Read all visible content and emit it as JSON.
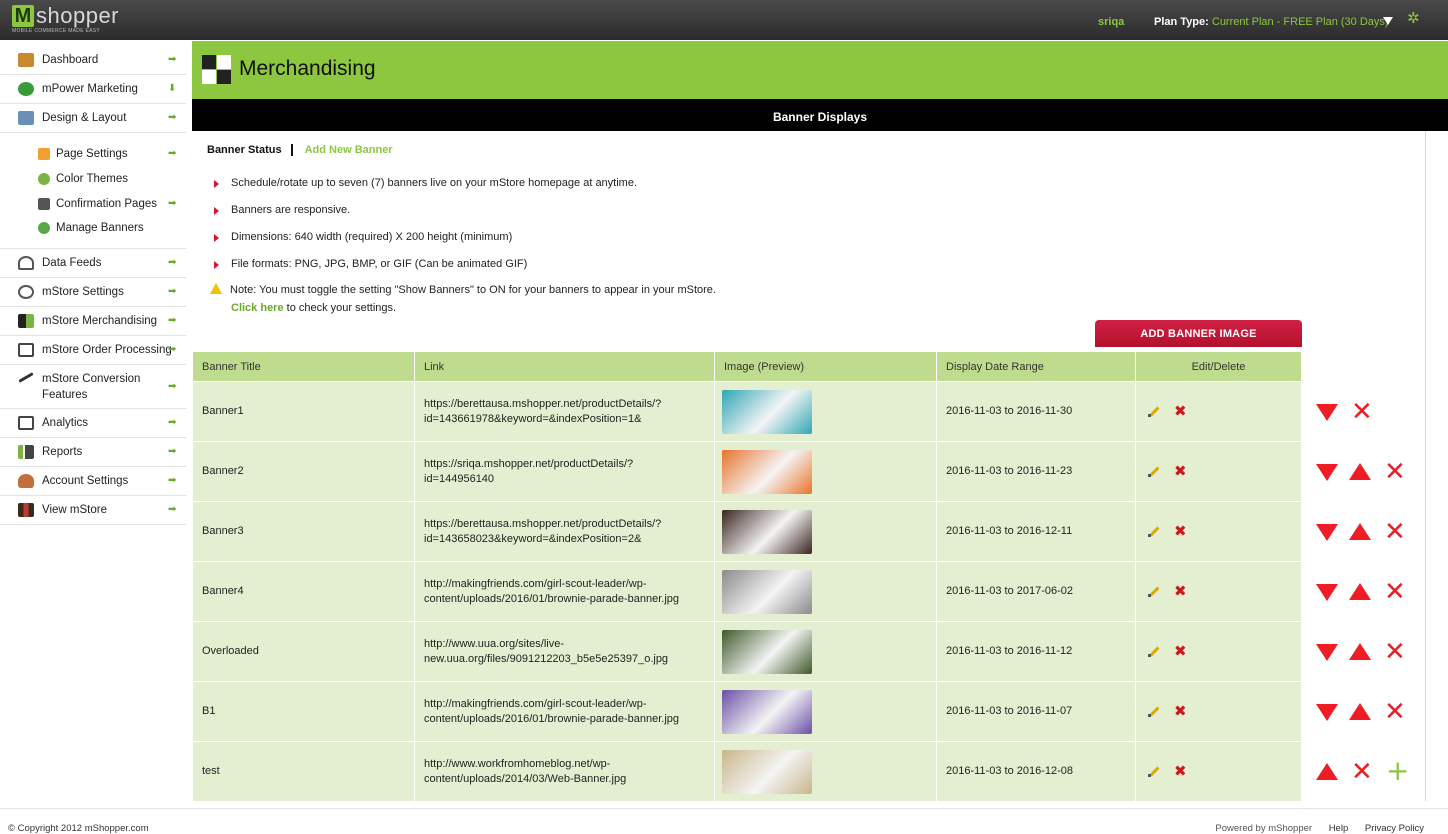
{
  "brand": {
    "logo_letter": "M",
    "logo_word": "shopper",
    "tagline": "MOBILE COMMERCE MADE EASY"
  },
  "topbar": {
    "user": "sriqa",
    "plan_label": "Plan Type:",
    "plan_value": "Current Plan - FREE Plan (30 Days)"
  },
  "sidebar": {
    "items": [
      {
        "label": "Dashboard",
        "icon": "home-icon"
      },
      {
        "label": "mPower Marketing",
        "icon": "marketing-icon"
      },
      {
        "label": "Design & Layout",
        "icon": "layout-icon"
      },
      {
        "label": "Data Feeds",
        "icon": "data-feeds-icon"
      },
      {
        "label": "mStore Settings",
        "icon": "settings-icon"
      },
      {
        "label": "mStore Merchandising",
        "icon": "merchandising-icon"
      },
      {
        "label": "mStore Order Processing",
        "icon": "order-processing-icon"
      },
      {
        "label": "mStore Conversion Features",
        "icon": "conversion-icon"
      },
      {
        "label": "Analytics",
        "icon": "analytics-icon"
      },
      {
        "label": "Reports",
        "icon": "reports-icon"
      },
      {
        "label": "Account Settings",
        "icon": "account-icon"
      },
      {
        "label": "View mStore",
        "icon": "store-icon"
      }
    ],
    "subitems": [
      {
        "label": "Page Settings",
        "icon": "page-icon"
      },
      {
        "label": "Color Themes",
        "icon": "palette-icon"
      },
      {
        "label": "Confirmation Pages",
        "icon": "confirmation-icon"
      },
      {
        "label": "Manage Banners",
        "icon": "banner-icon"
      }
    ]
  },
  "header": {
    "title": "Merchandising",
    "section": "Banner Displays"
  },
  "tabs": {
    "status": "Banner Status",
    "add": "Add New Banner"
  },
  "bullets": [
    "Schedule/rotate up to seven (7) banners live on your mStore homepage at anytime.",
    "Banners are responsive.",
    "Dimensions: 640 width (required) X 200 height (minimum)",
    "File formats: PNG, JPG, BMP, or GIF (Can be animated GIF)"
  ],
  "note": {
    "text": "Note: You must toggle the setting \"Show Banners\" to ON for your banners to appear in your mStore.",
    "link": "Click here",
    "link_suffix": " to check your settings."
  },
  "add_button": "ADD BANNER IMAGE",
  "table": {
    "headers": [
      "Banner Title",
      "Link",
      "Image (Preview)",
      "Display Date Range",
      "Edit/Delete"
    ],
    "rows": [
      {
        "title": "Banner1",
        "link": "https://berettausa.mshopper.net/productDetails/?id=143661978&keyword=&indexPosition=1&",
        "range": "2016-11-03 to 2016-11-30",
        "thumb_color": "#2fa7b5"
      },
      {
        "title": "Banner2",
        "link": "https://sriqa.mshopper.net/productDetails/?id=144956140",
        "range": "2016-11-03 to 2016-11-23",
        "thumb_color": "#e8742a"
      },
      {
        "title": "Banner3",
        "link": "https://berettausa.mshopper.net/productDetails/?id=143658023&keyword=&indexPosition=2&",
        "range": "2016-11-03 to 2016-12-11",
        "thumb_color": "#3a2520"
      },
      {
        "title": "Banner4",
        "link": "http://makingfriends.com/girl-scout-leader/wp-content/uploads/2016/01/brownie-parade-banner.jpg",
        "range": "2016-11-03 to 2017-06-02",
        "thumb_color": "#8a8a8a"
      },
      {
        "title": "Overloaded",
        "link": "http://www.uua.org/sites/live-new.uua.org/files/9091212203_b5e5e25397_o.jpg",
        "range": "2016-11-03 to 2016-11-12",
        "thumb_color": "#3d5a2a"
      },
      {
        "title": "B1",
        "link": "http://makingfriends.com/girl-scout-leader/wp-content/uploads/2016/01/brownie-parade-banner.jpg",
        "range": "2016-11-03 to 2016-11-07",
        "thumb_color": "#6a4fa8"
      },
      {
        "title": "test",
        "link": "http://www.workfromhomeblog.net/wp-content/uploads/2014/03/Web-Banner.jpg",
        "range": "2016-11-03 to 2016-12-08",
        "thumb_color": "#c9b58a"
      }
    ]
  },
  "footer": {
    "copyright": "© Copyright 2012 mShopper.com",
    "powered": "Powered by mShopper",
    "help": "Help",
    "privacy": "Privacy Policy"
  },
  "colors": {
    "accent": "#8dc63f",
    "danger": "#ee1c24",
    "button": "#c8183a"
  }
}
